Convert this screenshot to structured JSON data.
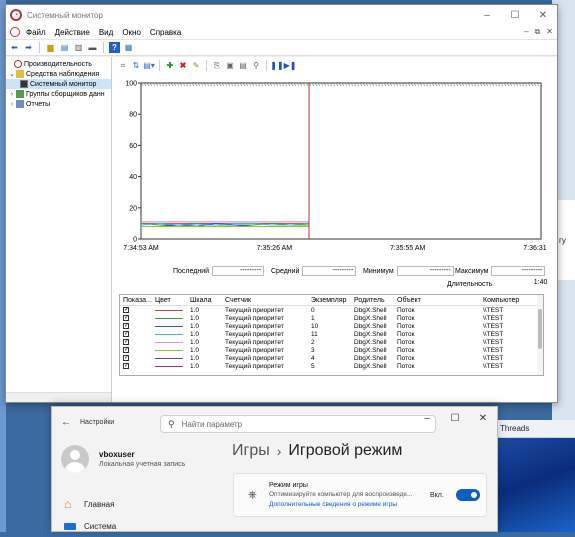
{
  "perfmon": {
    "window_title": "Системный монитор",
    "menu": [
      "Файл",
      "Действие",
      "Вид",
      "Окно",
      "Справка"
    ],
    "tree": [
      {
        "label": "Производительность",
        "exp": "",
        "level": 0
      },
      {
        "label": "Средства наблюдения",
        "exp": "⌄",
        "level": 1
      },
      {
        "label": "Системный монитор",
        "exp": "",
        "level": 2
      },
      {
        "label": "Группы сборщиков данн",
        "exp": "›",
        "level": 1
      },
      {
        "label": "Отчеты",
        "exp": "›",
        "level": 1
      }
    ],
    "chart_data": {
      "type": "line",
      "ylim": [
        0,
        100
      ],
      "yticks": [
        0,
        20,
        40,
        60,
        80,
        100
      ],
      "xticks": [
        "7:34:53 AM",
        "7:35:26 AM",
        "7:35:55 AM",
        "7:36:31 AM"
      ],
      "series": [
        {
          "color": "#d04040",
          "values": [
            10,
            10,
            10,
            10,
            10,
            10,
            10,
            10,
            10,
            10
          ]
        },
        {
          "color": "#3aa03a",
          "values": [
            10,
            9,
            9,
            10,
            9,
            9,
            9,
            10,
            9,
            9
          ]
        },
        {
          "color": "#3050d0",
          "values": [
            8,
            8,
            9,
            8,
            10,
            9,
            8,
            8,
            8,
            8
          ]
        },
        {
          "color": "#40b8c8",
          "values": [
            9,
            10,
            9,
            9,
            9,
            10,
            10,
            9,
            9,
            10
          ]
        },
        {
          "color": "#e090e0",
          "values": [
            11,
            11,
            11,
            11,
            11,
            11,
            11,
            11,
            11,
            11
          ]
        },
        {
          "color": "#88c840",
          "values": [
            8,
            8,
            8,
            8,
            8,
            8,
            8,
            8,
            8,
            8
          ]
        }
      ]
    },
    "stats": {
      "last_label": "Последний",
      "last_value": "---------",
      "avg_label": "Средний",
      "avg_value": "---------",
      "min_label": "Минимум",
      "min_value": "---------",
      "max_label": "Максимум",
      "max_value": "---------",
      "dur_label": "Длительность",
      "dur_value": "1:40"
    },
    "legend": {
      "headers": [
        "Показа...",
        "Цвет",
        "Шкала",
        "Счетчик",
        "Экземпляр",
        "Родитель",
        "Объект",
        "Компьютер"
      ],
      "rows": [
        {
          "color": "#d04040",
          "scale": "1.0",
          "counter": "Текущий приоритет",
          "instance": "0",
          "parent": "DbgX.Shell",
          "object": "Поток",
          "computer": "\\\\TEST"
        },
        {
          "color": "#3aa03a",
          "scale": "1.0",
          "counter": "Текущий приоритет",
          "instance": "1",
          "parent": "DbgX.Shell",
          "object": "Поток",
          "computer": "\\\\TEST"
        },
        {
          "color": "#3050d0",
          "scale": "1.0",
          "counter": "Текущий приоритет",
          "instance": "10",
          "parent": "DbgX.Shell",
          "object": "Поток",
          "computer": "\\\\TEST"
        },
        {
          "color": "#40b8c8",
          "scale": "1.0",
          "counter": "Текущий приоритет",
          "instance": "11",
          "parent": "DbgX.Shell",
          "object": "Поток",
          "computer": "\\\\TEST"
        },
        {
          "color": "#e090e0",
          "scale": "1.0",
          "counter": "Текущий приоритет",
          "instance": "2",
          "parent": "DbgX.Shell",
          "object": "Поток",
          "computer": "\\\\TEST"
        },
        {
          "color": "#88c840",
          "scale": "1.0",
          "counter": "Текущий приоритет",
          "instance": "3",
          "parent": "DbgX.Shell",
          "object": "Поток",
          "computer": "\\\\TEST"
        },
        {
          "color": "#6040a0",
          "scale": "1.0",
          "counter": "Текущий приоритет",
          "instance": "4",
          "parent": "DbgX.Shell",
          "object": "Поток",
          "computer": "\\\\TEST"
        },
        {
          "color": "#b03060",
          "scale": "1.0",
          "counter": "Текущий приоритет",
          "instance": "5",
          "parent": "DbgX.Shell",
          "object": "Поток",
          "computer": "\\\\TEST"
        }
      ]
    }
  },
  "settings": {
    "app_title": "Настройки",
    "search_placeholder": "Найти параметр",
    "user_name": "vboxuser",
    "user_type": "Локальная учетная запись",
    "nav": [
      {
        "label": "Главная",
        "icon": "home-icon"
      },
      {
        "label": "Система",
        "icon": "system-icon"
      }
    ],
    "breadcrumb_parent": "Игры",
    "breadcrumb_current": "Игровой режим",
    "game_mode": {
      "title": "Режим игры",
      "desc": "Оптимизируйте компьютер для воспроизведе...",
      "link": "Дополнительные сведения о режиме игры",
      "state": "Вкл."
    }
  },
  "background": {
    "threads_label": "Threads",
    "side_text": "гу"
  }
}
